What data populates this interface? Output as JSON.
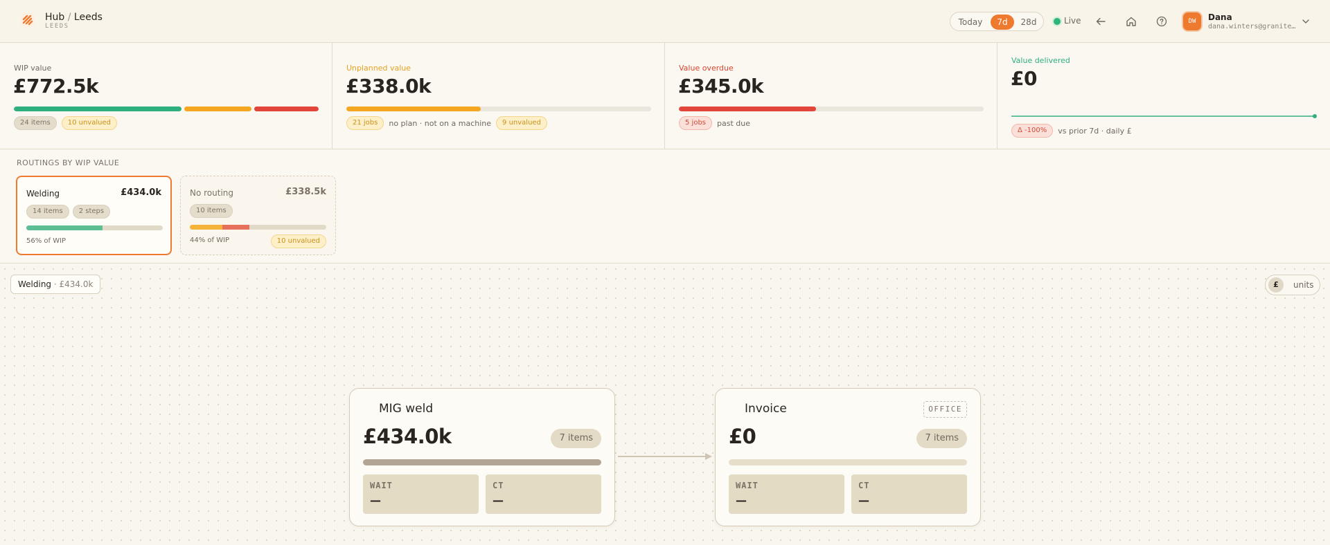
{
  "header": {
    "title": "Hub",
    "site": "Leeds",
    "subtitle": "LEEDS",
    "range": {
      "today": "Today",
      "d7": "7d",
      "d28": "28d",
      "selected": "7d"
    },
    "live_label": "Live",
    "icons": [
      "back-arrow-icon",
      "home-icon",
      "help-icon",
      "chevron-down-icon"
    ],
    "user": {
      "initials": "DW",
      "name": "Dana",
      "email": "dana.winters@granitep…"
    }
  },
  "kpis": [
    {
      "label": "WIP value",
      "label_color": "#6f675e",
      "value": "£772.5k",
      "pills": [
        "24 items",
        "10 unvalued"
      ],
      "bar_segments": [
        {
          "color": "#2fae7e",
          "fraction": 0.56
        },
        {
          "color": "#f5a623",
          "fraction": 0.23
        },
        {
          "color": "#e2463a",
          "fraction": 0.2
        }
      ]
    },
    {
      "label": "Unplanned value",
      "label_color": "#e6a220",
      "value": "£338.0k",
      "pill_left": "21 jobs",
      "note": "no plan · not on a machine",
      "pill_right": "9 unvalued",
      "bar_fill": 0.44,
      "bar_color": "#f5a623"
    },
    {
      "label": "Value overdue",
      "label_color": "#d9432f",
      "value": "£345.0k",
      "pill": "5 jobs",
      "note": "past due",
      "bar_fill": 0.45,
      "bar_color": "#e2463a"
    },
    {
      "label": "Value delivered",
      "label_color": "#2fae7e",
      "value": "£0",
      "pill": "Δ -100%",
      "note": "vs prior 7d · daily £"
    }
  ],
  "routings": {
    "title": "ROUTINGS BY WIP VALUE",
    "cards": [
      {
        "name": "Welding",
        "value": "£434.0k",
        "pills": [
          "14 items",
          "2 steps"
        ],
        "share": "56% of WIP",
        "bar": [
          {
            "color": "#5cbf94",
            "fraction": 0.56
          }
        ]
      },
      {
        "name": "No routing",
        "value": "£338.5k",
        "pills": [
          "10 items"
        ],
        "share": "44% of WIP",
        "extra": "10 unvalued",
        "bar": [
          {
            "color": "#f5b33a",
            "fraction": 0.24
          },
          {
            "color": "#e6705c",
            "fraction": 0.2
          }
        ]
      }
    ]
  },
  "canvas": {
    "route_chip": {
      "name": "Welding",
      "value": "· £434.0k"
    },
    "units_toggle": {
      "pound": "£",
      "units": "units",
      "selected": "£"
    },
    "nodes": [
      {
        "name": "MIG weld",
        "value": "£434.0k",
        "items": "7 items",
        "bar_fill": 1.0,
        "wait_label": "WAIT",
        "wait_value": "—",
        "ct_label": "CT",
        "ct_value": "—"
      },
      {
        "name": "Invoice",
        "badge": "OFFICE",
        "value": "£0",
        "items": "7 items",
        "bar_fill": 0.0,
        "wait_label": "WAIT",
        "wait_value": "—",
        "ct_label": "CT",
        "ct_value": "—"
      }
    ]
  }
}
